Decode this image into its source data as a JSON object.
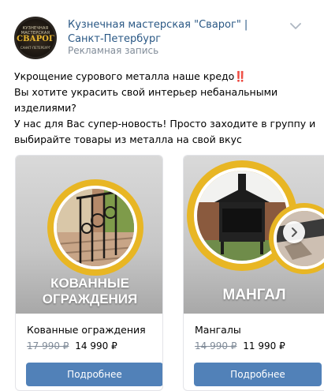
{
  "header": {
    "avatar_top": "КУЗНЕЧНАЯ МАСТЕРСКАЯ",
    "avatar_mid": "СВАРОГ",
    "avatar_bot": "САНКТ-ПЕТЕРБУРГ",
    "title": "Кузнечная мастерская \"Сварог\" | Санкт-Петербург",
    "subtitle": "Рекламная запись"
  },
  "text": {
    "line1": "Укрощение сурового металла наше кредо",
    "line1_mark": "‼️",
    "line2": "Вы хотите украсить свой интерьер небанальными",
    "line3": "изделиями?",
    "line4": "У нас для Вас супер-новость! Просто заходите в группу и",
    "line5": "выбирайте товары из металла на свой вкус"
  },
  "cards": [
    {
      "caption": "КОВАННЫЕ ОГРАЖДЕНИЯ",
      "caption_line1": "КОВАННЫЕ",
      "caption_line2": "ОГРАЖДЕНИЯ",
      "name": "Кованные ограждения",
      "old_price": "17 990 ₽",
      "new_price": "14 990 ₽",
      "button": "Подробнее"
    },
    {
      "caption": "МАНГАЛ",
      "name": "Мангалы",
      "old_price": "14 990 ₽",
      "new_price": "11 990 ₽",
      "button": "Подробнее"
    }
  ],
  "colors": {
    "link": "#2a5885",
    "button": "#5181b8",
    "accent_ring": "#e8b624",
    "muted": "#818c99"
  }
}
